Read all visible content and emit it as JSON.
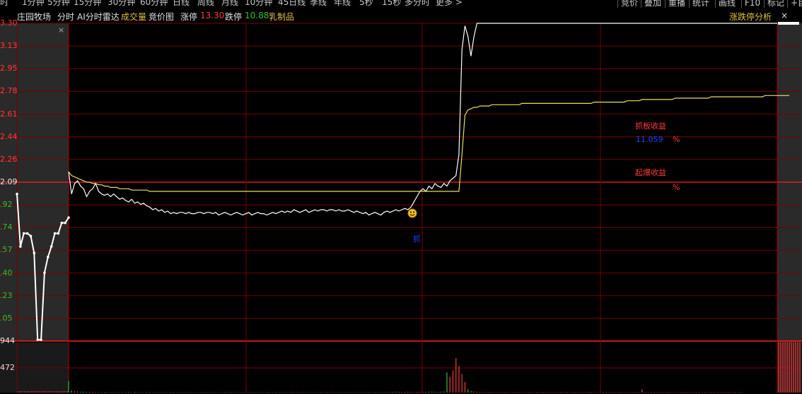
{
  "toolbar": {
    "periods": [
      "时",
      "1分钟",
      "5分钟",
      "15分钟",
      "30分钟",
      "60分钟",
      "日线",
      "周线",
      "月线",
      "10分钟",
      "45日线",
      "季线",
      "年线",
      "5秒",
      "15秒",
      "多分时",
      "更多 >"
    ],
    "right_buttons": [
      "竞价",
      "叠加",
      "重播",
      "统计",
      "画线",
      "F10",
      "标记",
      "+自"
    ]
  },
  "header": {
    "stock_name": "庄园牧场",
    "tab_intraday": "分时",
    "tab_ai": "AI分时雷达",
    "volume": "成交量",
    "auction": "竞价图",
    "limit_up_label": "涨停",
    "limit_up_value": "13.30",
    "limit_down_label": "跌停",
    "limit_down_value": "10.88",
    "sector": "乳制品",
    "analysis": "涨跌停分析",
    "close_mark": "×"
  },
  "annotations": {
    "grab_profit_label": "抓板收益",
    "grab_profit_value": "11.059",
    "percent1": "%",
    "burst_profit_label": "起爆收益",
    "percent2": "%",
    "grab_marker": "抓"
  },
  "colors": {
    "up": "#ff3b3b",
    "down": "#2ec22e",
    "neutral": "#e8e8e8",
    "grid": "#7a0000",
    "avg": "#e8e060",
    "gold": "#e0c040",
    "blue": "#2040ff"
  },
  "chart_data": {
    "type": "line",
    "y_ticks": [
      {
        "label": "3.30",
        "color": "up"
      },
      {
        "label": "3.13",
        "color": "up"
      },
      {
        "label": "2.95",
        "color": "up"
      },
      {
        "label": "2.78",
        "color": "up"
      },
      {
        "label": "2.61",
        "color": "up"
      },
      {
        "label": "2.44",
        "color": "up"
      },
      {
        "label": "2.26",
        "color": "up"
      },
      {
        "label": "2.09",
        "color": "neutral"
      },
      {
        "label": ".92",
        "color": "down"
      },
      {
        "label": ".74",
        "color": "down"
      },
      {
        "label": ".57",
        "color": "down"
      },
      {
        "label": ".40",
        "color": "down"
      },
      {
        "label": ".23",
        "color": "down"
      },
      {
        "label": ".05",
        "color": "down"
      },
      {
        "label": "944",
        "color": "neutral"
      }
    ],
    "volume_ticks": [
      "472"
    ],
    "ylim": [
      10.88,
      13.3
    ],
    "prev_close": 12.09,
    "auction_price": [
      12.0,
      11.6,
      11.7,
      11.7,
      11.68,
      11.55,
      10.89,
      10.89,
      11.4,
      11.52,
      11.6,
      11.7,
      11.7,
      11.78,
      11.78,
      11.82
    ],
    "price": [
      12.17,
      12.0,
      12.08,
      12.1,
      12.06,
      12.04,
      11.98,
      12.02,
      12.04,
      12.08,
      12.02,
      12.0,
      11.99,
      12.0,
      11.98,
      12.0,
      11.98,
      11.96,
      11.97,
      11.95,
      11.94,
      11.96,
      11.93,
      11.94,
      11.92,
      11.93,
      11.91,
      11.9,
      11.88,
      11.89,
      11.87,
      11.88,
      11.86,
      11.87,
      11.85,
      11.86,
      11.85,
      11.86,
      11.86,
      11.85,
      11.86,
      11.85,
      11.85,
      11.86,
      11.86,
      11.85,
      11.86,
      11.86,
      11.85,
      11.86,
      11.84,
      11.85,
      11.86,
      11.85,
      11.84,
      11.85,
      11.86,
      11.85,
      11.84,
      11.85,
      11.86,
      11.84,
      11.85,
      11.86,
      11.85,
      11.85,
      11.84,
      11.85,
      11.86,
      11.85,
      11.86,
      11.87,
      11.86,
      11.87,
      11.86,
      11.88,
      11.87,
      11.86,
      11.87,
      11.88,
      11.86,
      11.87,
      11.88,
      11.87,
      11.88,
      11.88,
      11.87,
      11.88,
      11.88,
      11.87,
      11.88,
      11.87,
      11.87,
      11.88,
      11.87,
      11.86,
      11.87,
      11.86,
      11.85,
      11.86,
      11.84,
      11.85,
      11.86,
      11.85,
      11.84,
      11.86,
      11.87,
      11.86,
      11.87,
      11.88,
      11.87,
      11.88,
      11.89,
      11.88,
      11.9,
      11.94,
      11.98,
      12.02,
      12.04,
      12.02,
      12.06,
      12.04,
      12.08,
      12.06,
      12.05,
      12.08,
      12.06,
      12.1,
      12.12,
      12.14,
      12.3,
      13.1,
      13.28,
      13.2,
      13.05,
      13.2,
      13.3,
      13.3,
      13.3,
      13.3,
      13.3,
      13.3,
      13.3,
      13.3,
      13.3,
      13.3,
      13.3,
      13.3,
      13.3,
      13.3,
      13.3,
      13.3,
      13.3,
      13.3,
      13.3,
      13.3,
      13.3,
      13.3,
      13.3,
      13.3,
      13.3,
      13.3,
      13.3,
      13.3,
      13.3,
      13.3,
      13.3,
      13.3,
      13.3,
      13.3,
      13.3,
      13.3,
      13.3,
      13.3,
      13.3,
      13.3,
      13.3,
      13.3,
      13.3,
      13.3,
      13.3,
      13.3,
      13.3,
      13.3,
      13.3,
      13.3,
      13.3,
      13.3,
      13.3,
      13.3,
      13.3,
      13.3,
      13.3,
      13.3,
      13.3,
      13.3,
      13.3,
      13.3,
      13.3,
      13.3,
      13.3,
      13.3,
      13.3,
      13.3,
      13.3,
      13.3,
      13.3,
      13.3,
      13.3,
      13.3,
      13.3,
      13.3,
      13.3,
      13.3,
      13.3,
      13.3,
      13.3,
      13.3,
      13.3,
      13.3,
      13.3,
      13.3,
      13.3,
      13.3,
      13.3,
      13.3,
      13.3,
      13.3,
      13.3,
      13.3,
      13.3,
      13.3,
      13.3,
      13.3,
      13.3,
      13.3,
      13.3
    ],
    "avg_price": [
      12.17,
      12.14,
      12.13,
      12.12,
      12.11,
      12.1,
      12.09,
      12.09,
      12.08,
      12.08,
      12.07,
      12.07,
      12.06,
      12.06,
      12.05,
      12.05,
      12.05,
      12.04,
      12.04,
      12.04,
      12.04,
      12.03,
      12.03,
      12.03,
      12.03,
      12.03,
      12.03,
      12.02,
      12.02,
      12.02,
      12.02,
      12.02,
      12.02,
      12.02,
      12.02,
      12.02,
      12.02,
      12.02,
      12.02,
      12.02,
      12.02,
      12.02,
      12.02,
      12.02,
      12.02,
      12.02,
      12.02,
      12.02,
      12.02,
      12.02,
      12.02,
      12.02,
      12.02,
      12.02,
      12.02,
      12.02,
      12.02,
      12.02,
      12.02,
      12.02,
      12.02,
      12.02,
      12.02,
      12.02,
      12.02,
      12.02,
      12.02,
      12.02,
      12.02,
      12.02,
      12.02,
      12.02,
      12.02,
      12.02,
      12.02,
      12.02,
      12.02,
      12.02,
      12.02,
      12.02,
      12.02,
      12.02,
      12.02,
      12.02,
      12.02,
      12.02,
      12.02,
      12.02,
      12.02,
      12.02,
      12.02,
      12.02,
      12.02,
      12.02,
      12.02,
      12.02,
      12.02,
      12.02,
      12.02,
      12.02,
      12.02,
      12.02,
      12.02,
      12.02,
      12.02,
      12.02,
      12.02,
      12.02,
      12.02,
      12.02,
      12.02,
      12.02,
      12.02,
      12.02,
      12.02,
      12.02,
      12.02,
      12.02,
      12.02,
      12.02,
      12.02,
      12.02,
      12.02,
      12.02,
      12.02,
      12.02,
      12.02,
      12.02,
      12.02,
      12.02,
      12.02,
      12.3,
      12.6,
      12.64,
      12.65,
      12.66,
      12.66,
      12.67,
      12.67,
      12.67,
      12.67,
      12.68,
      12.68,
      12.68,
      12.68,
      12.68,
      12.68,
      12.68,
      12.68,
      12.68,
      12.68,
      12.69,
      12.69,
      12.69,
      12.69,
      12.69,
      12.69,
      12.69,
      12.69,
      12.69,
      12.69,
      12.69,
      12.69,
      12.69,
      12.69,
      12.69,
      12.69,
      12.69,
      12.69,
      12.69,
      12.69,
      12.69,
      12.69,
      12.69,
      12.69,
      12.7,
      12.7,
      12.7,
      12.7,
      12.7,
      12.7,
      12.7,
      12.7,
      12.7,
      12.7,
      12.7,
      12.71,
      12.71,
      12.71,
      12.71,
      12.71,
      12.72,
      12.72,
      12.72,
      12.72,
      12.72,
      12.72,
      12.72,
      12.72,
      12.72,
      12.72,
      12.72,
      12.73,
      12.73,
      12.73,
      12.73,
      12.73,
      12.73,
      12.73,
      12.73,
      12.73,
      12.73,
      12.73,
      12.73,
      12.74,
      12.74,
      12.74,
      12.74,
      12.74,
      12.74,
      12.74,
      12.74,
      12.74,
      12.74,
      12.74,
      12.74,
      12.74,
      12.74,
      12.74,
      12.74,
      12.74,
      12.74,
      12.75,
      12.75,
      12.75,
      12.75,
      12.75,
      12.75,
      12.75,
      12.75,
      12.75
    ],
    "volume": [
      220,
      40,
      25,
      20,
      15,
      18,
      12,
      15,
      10,
      12,
      10,
      8,
      12,
      10,
      8,
      10,
      8,
      8,
      10,
      8,
      12,
      8,
      15,
      8,
      10,
      8,
      8,
      12,
      8,
      10,
      8,
      10,
      8,
      8,
      12,
      8,
      8,
      10,
      8,
      8,
      10,
      8,
      8,
      10,
      8,
      12,
      8,
      8,
      10,
      8,
      8,
      10,
      8,
      8,
      10,
      8,
      8,
      10,
      8,
      8,
      10,
      8,
      8,
      10,
      8,
      8,
      10,
      8,
      8,
      10,
      8,
      8,
      10,
      8,
      8,
      10,
      8,
      8,
      10,
      8,
      8,
      10,
      8,
      8,
      10,
      8,
      8,
      10,
      8,
      8,
      10,
      8,
      8,
      10,
      8,
      8,
      10,
      8,
      8,
      10,
      8,
      8,
      10,
      8,
      8,
      12,
      15,
      10,
      12,
      18,
      15,
      12,
      10,
      15,
      12,
      10,
      14,
      16,
      12,
      15,
      18,
      20,
      15,
      12,
      16,
      20,
      380,
      300,
      420,
      650,
      500,
      350,
      200,
      60,
      30,
      20,
      15,
      12,
      10,
      15,
      12,
      10,
      8,
      10,
      8,
      12,
      10,
      8,
      10,
      12,
      8,
      10,
      8,
      10,
      12,
      8,
      10,
      8,
      12,
      10,
      8,
      10,
      8,
      10,
      12,
      8,
      10,
      8,
      12,
      10,
      8,
      10,
      8,
      10,
      12,
      8,
      10,
      8,
      12,
      10,
      8,
      10,
      8,
      10,
      12,
      8,
      10,
      8,
      12,
      10,
      8,
      60,
      10,
      8,
      10,
      12,
      8,
      10,
      8,
      12,
      10,
      8,
      10,
      8,
      10,
      12,
      8,
      10,
      8,
      12,
      10,
      8,
      10,
      8,
      10,
      12,
      8,
      10,
      8,
      12,
      10,
      8,
      10,
      8,
      10
    ],
    "vol_max": 944
  }
}
